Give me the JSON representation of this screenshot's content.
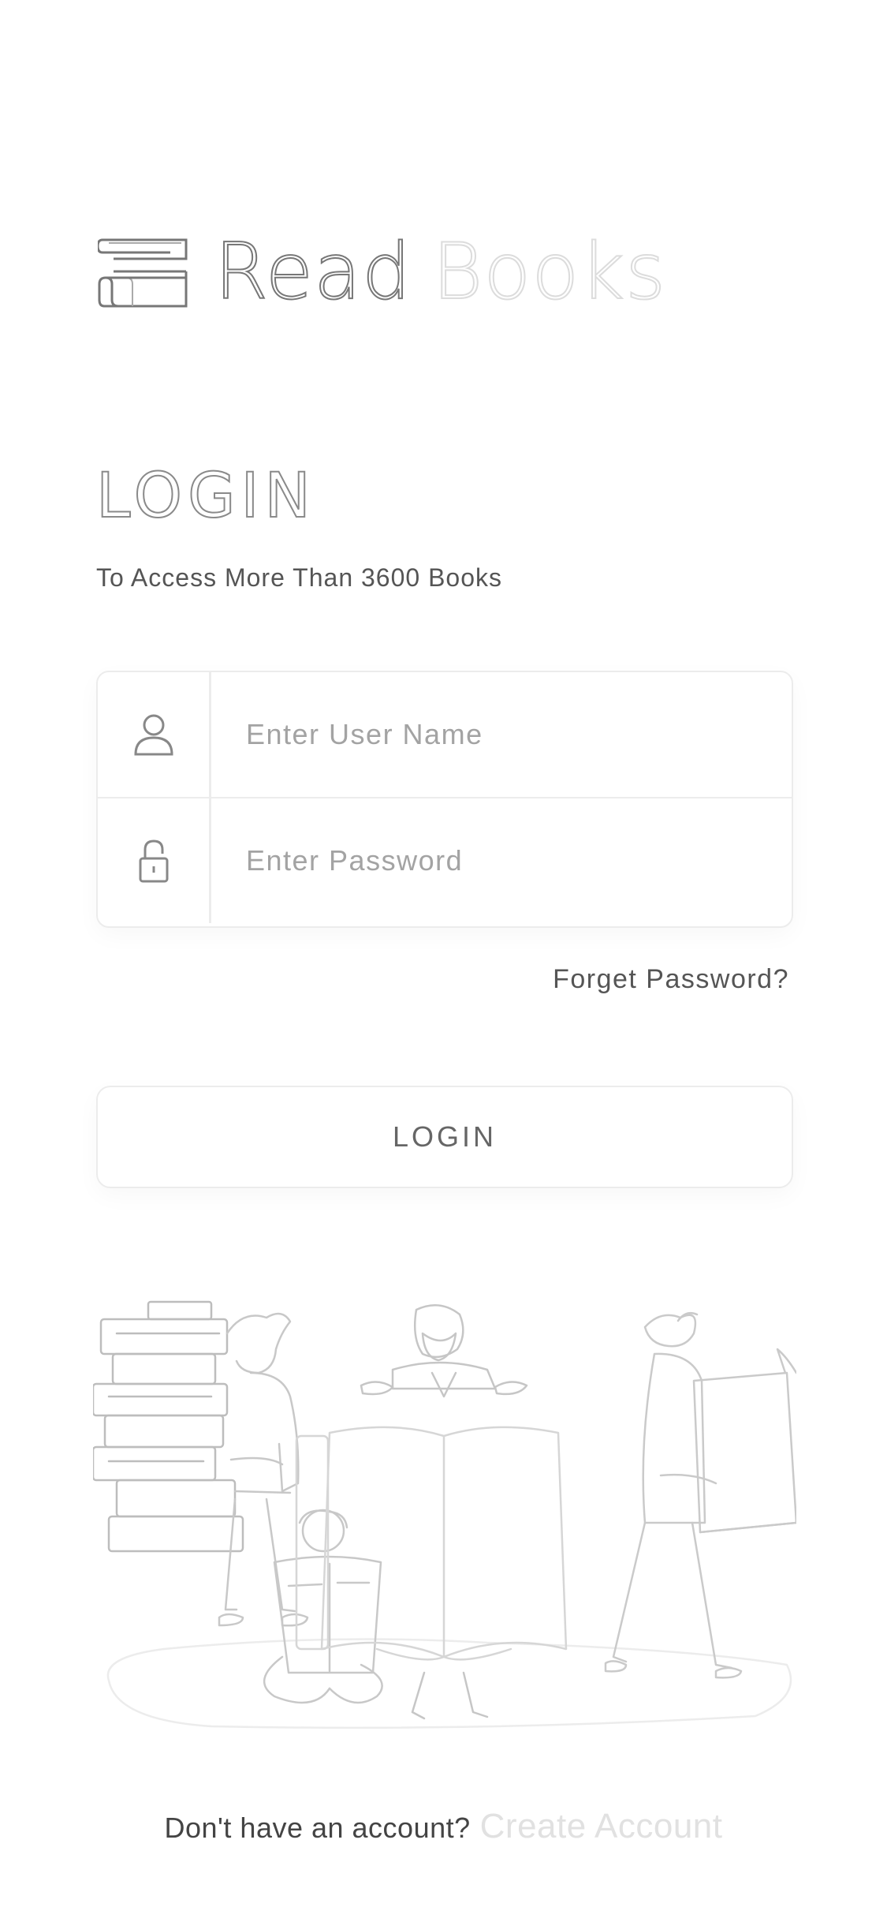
{
  "logo": {
    "word_read": "Read",
    "word_books": "Books",
    "icon": "books-stack-icon"
  },
  "login": {
    "title": "LOGIN",
    "subtitle": "To Access More Than 3600 Books"
  },
  "form": {
    "username": {
      "placeholder": "Enter User Name",
      "value": "",
      "icon": "user-icon"
    },
    "password": {
      "placeholder": "Enter Password",
      "value": "",
      "icon": "lock-icon"
    },
    "forget_label": "Forget Password?",
    "submit_label": "LOGIN"
  },
  "illustration": {
    "icon": "people-reading-books-illustration"
  },
  "footer": {
    "prompt": "Don't have an account?",
    "create_label": "Create Account"
  },
  "colors": {
    "background": "#ffffff",
    "text": "#555555",
    "muted": "#a3a3a3",
    "border": "#ececec",
    "faint_accent": "#dcdcdc"
  }
}
